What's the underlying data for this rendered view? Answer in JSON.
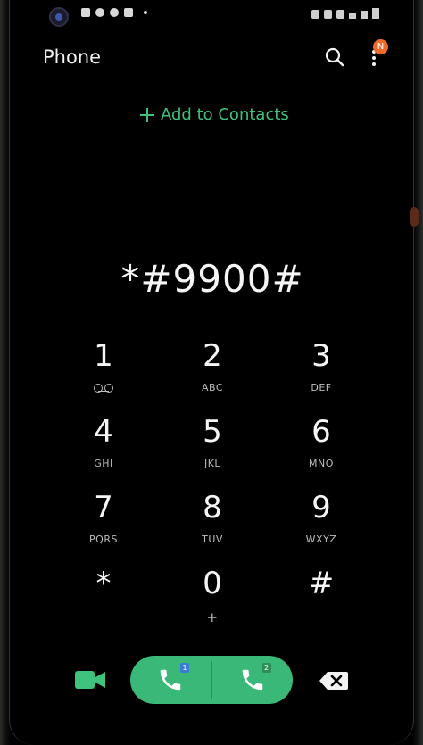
{
  "header": {
    "title": "Phone",
    "badge": "N",
    "search_icon": "search-icon",
    "more_icon": "more-options-icon"
  },
  "add_contacts": {
    "label": "Add to Contacts",
    "icon": "plus-icon"
  },
  "dialer": {
    "number": "*#9900#"
  },
  "keypad": {
    "keys": [
      {
        "digit": "1",
        "letters": ""
      },
      {
        "digit": "2",
        "letters": "ABC"
      },
      {
        "digit": "3",
        "letters": "DEF"
      },
      {
        "digit": "4",
        "letters": "GHI"
      },
      {
        "digit": "5",
        "letters": "JKL"
      },
      {
        "digit": "6",
        "letters": "MNO"
      },
      {
        "digit": "7",
        "letters": "PQRS"
      },
      {
        "digit": "8",
        "letters": "TUV"
      },
      {
        "digit": "9",
        "letters": "WXYZ"
      },
      {
        "digit": "*",
        "letters": ""
      },
      {
        "digit": "0",
        "letters": "+"
      },
      {
        "digit": "#",
        "letters": ""
      }
    ]
  },
  "call_bar": {
    "sim1_label": "1",
    "sim2_label": "2"
  },
  "colors": {
    "accent_green": "#3fc27b",
    "call_green": "#3ab878",
    "badge_orange": "#f06a2a"
  }
}
